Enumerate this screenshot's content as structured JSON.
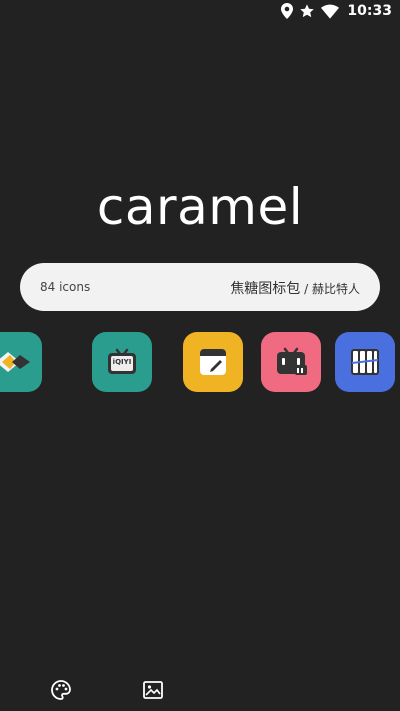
{
  "status_bar": {
    "time": "10:33",
    "icons": [
      "location-icon",
      "star-icon",
      "wifi-icon"
    ]
  },
  "app": {
    "title": "caramel"
  },
  "info_pill": {
    "icon_count": "84 icons",
    "name_main": "焦糖图标包",
    "name_sep": " / ",
    "author": "赫比特人"
  },
  "icons_row": [
    {
      "name": "app-icon-partial",
      "color": "#2a9d8f"
    },
    {
      "name": "iqiyi-icon",
      "color": "#2a9d8f",
      "text": "iQIYI"
    },
    {
      "name": "notes-icon",
      "color": "#f0b323"
    },
    {
      "name": "bilibili-icon",
      "color": "#f06a82"
    },
    {
      "name": "bars-icon",
      "color": "#4a70e0"
    }
  ],
  "bottom_nav": [
    "palette-icon",
    "wallpaper-icon"
  ],
  "colors": {
    "background": "#222222",
    "pill": "#f2f2f2"
  }
}
